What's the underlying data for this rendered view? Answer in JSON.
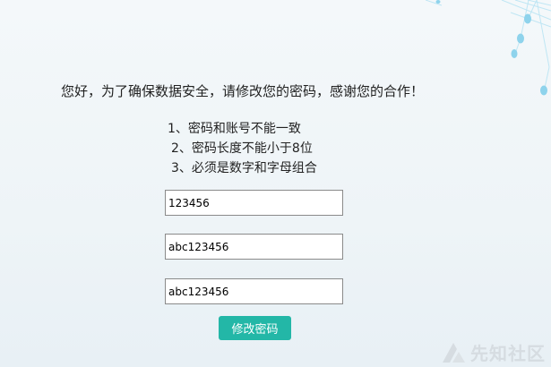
{
  "message": {
    "headline": "您好，为了确保数据安全，请修改您的密码，感谢您的合作！"
  },
  "rules": [
    "1、密码和账号不能一致",
    "2、密码长度不能小于8位",
    "3、必须是数字和字母组合"
  ],
  "form": {
    "fields": [
      {
        "value": "123456"
      },
      {
        "value": "abc123456"
      },
      {
        "value": "abc123456"
      }
    ],
    "submit_label": "修改密码"
  },
  "watermark": {
    "text": "先知社区"
  },
  "colors": {
    "button": "#23b7a7",
    "background": "#f4f8fa",
    "network": "#8ed3ec"
  },
  "icons": {
    "watermark_logo": "xianzhi-logo-icon",
    "background": "network-graph-decoration"
  }
}
